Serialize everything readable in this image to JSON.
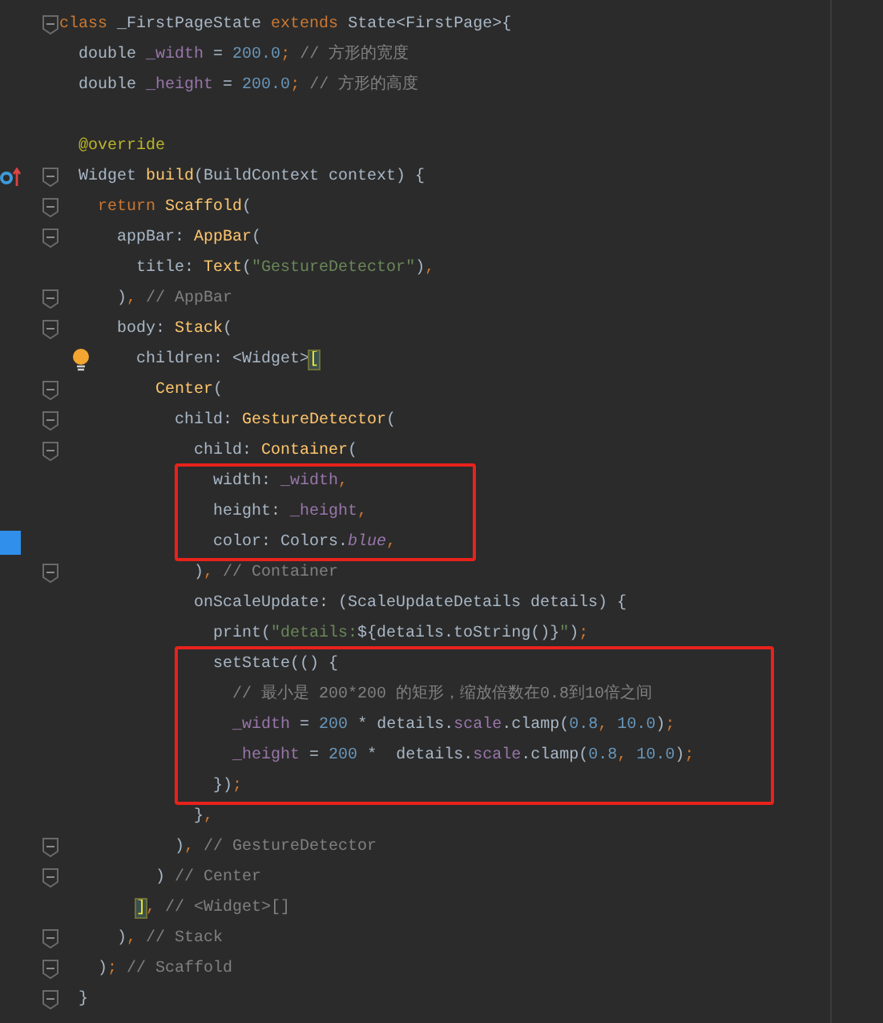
{
  "lines": [
    {
      "kind": "line",
      "fold": true,
      "tokens": [
        {
          "kind": "keyword",
          "text": "class"
        },
        {
          "kind": "plain",
          "text": " _FirstPageState "
        },
        {
          "kind": "keyword",
          "text": "extends"
        },
        {
          "kind": "plain",
          "text": " State<FirstPage>{"
        }
      ]
    },
    {
      "kind": "line",
      "fold": false,
      "tokens": [
        {
          "kind": "plain",
          "text": "  double "
        },
        {
          "kind": "field",
          "text": "_width"
        },
        {
          "kind": "plain",
          "text": " = "
        },
        {
          "kind": "number",
          "text": "200.0"
        },
        {
          "kind": "punct",
          "text": ";"
        },
        {
          "kind": "comment",
          "text": " // 方形的宽度"
        }
      ]
    },
    {
      "kind": "line",
      "fold": false,
      "tokens": [
        {
          "kind": "plain",
          "text": "  double "
        },
        {
          "kind": "field",
          "text": "_height"
        },
        {
          "kind": "plain",
          "text": " = "
        },
        {
          "kind": "number",
          "text": "200.0"
        },
        {
          "kind": "punct",
          "text": ";"
        },
        {
          "kind": "comment",
          "text": " // 方形的高度"
        }
      ]
    },
    {
      "kind": "blank",
      "fold": false
    },
    {
      "kind": "line",
      "fold": false,
      "tokens": [
        {
          "kind": "annotation",
          "text": "  @override"
        }
      ]
    },
    {
      "kind": "line",
      "fold": true,
      "gutter_icon": {
        "kind": "override"
      },
      "tokens": [
        {
          "kind": "plain",
          "text": "  Widget "
        },
        {
          "kind": "call",
          "text": "build"
        },
        {
          "kind": "plain",
          "text": "(BuildContext context) {"
        }
      ]
    },
    {
      "kind": "line",
      "fold": true,
      "tokens": [
        {
          "kind": "keyword",
          "text": "    return "
        },
        {
          "kind": "call",
          "text": "Scaffold"
        },
        {
          "kind": "plain",
          "text": "("
        }
      ]
    },
    {
      "kind": "line",
      "fold": true,
      "tokens": [
        {
          "kind": "plain",
          "text": "      appBar: "
        },
        {
          "kind": "call",
          "text": "AppBar"
        },
        {
          "kind": "plain",
          "text": "("
        }
      ]
    },
    {
      "kind": "line",
      "fold": false,
      "tokens": [
        {
          "kind": "plain",
          "text": "        title: "
        },
        {
          "kind": "call",
          "text": "Text"
        },
        {
          "kind": "plain",
          "text": "("
        },
        {
          "kind": "string",
          "text": "\"GestureDetector\""
        },
        {
          "kind": "plain",
          "text": ")"
        },
        {
          "kind": "punct",
          "text": ","
        }
      ]
    },
    {
      "kind": "line",
      "fold": true,
      "tokens": [
        {
          "kind": "plain",
          "text": "      )"
        },
        {
          "kind": "punct",
          "text": ","
        },
        {
          "kind": "comment",
          "text": " // AppBar"
        }
      ]
    },
    {
      "kind": "line",
      "fold": true,
      "tokens": [
        {
          "kind": "plain",
          "text": "      body: "
        },
        {
          "kind": "call",
          "text": "Stack"
        },
        {
          "kind": "plain",
          "text": "("
        }
      ]
    },
    {
      "kind": "line",
      "fold": false,
      "gutter_icon": {
        "kind": "bulb"
      },
      "tokens": [
        {
          "kind": "plain",
          "text": "        children: <Widget>"
        },
        {
          "kind": "brace",
          "text": "["
        }
      ]
    },
    {
      "kind": "line",
      "fold": true,
      "tokens": [
        {
          "kind": "call",
          "text": "          Center"
        },
        {
          "kind": "plain",
          "text": "("
        }
      ]
    },
    {
      "kind": "line",
      "fold": true,
      "tokens": [
        {
          "kind": "plain",
          "text": "            child: "
        },
        {
          "kind": "call",
          "text": "GestureDetector"
        },
        {
          "kind": "plain",
          "text": "("
        }
      ]
    },
    {
      "kind": "line",
      "fold": true,
      "tokens": [
        {
          "kind": "plain",
          "text": "              child: "
        },
        {
          "kind": "call",
          "text": "Container"
        },
        {
          "kind": "plain",
          "text": "("
        }
      ]
    },
    {
      "kind": "box",
      "lines": [
        {
          "kind": "line",
          "fold": false,
          "tokens": [
            {
              "kind": "plain",
              "text": "                width: "
            },
            {
              "kind": "field",
              "text": "_width"
            },
            {
              "kind": "punct",
              "text": ","
            }
          ]
        },
        {
          "kind": "line",
          "fold": false,
          "tokens": [
            {
              "kind": "plain",
              "text": "                height: "
            },
            {
              "kind": "field",
              "text": "_height"
            },
            {
              "kind": "punct",
              "text": ","
            }
          ]
        },
        {
          "kind": "line",
          "fold": false,
          "gutter_icon": {
            "kind": "square"
          },
          "tokens": [
            {
              "kind": "plain",
              "text": "                color: Colors."
            },
            {
              "kind": "italic",
              "text": "blue"
            },
            {
              "kind": "punct",
              "text": ","
            }
          ]
        }
      ]
    },
    {
      "kind": "line",
      "fold": true,
      "tokens": [
        {
          "kind": "plain",
          "text": "              )"
        },
        {
          "kind": "punct",
          "text": ","
        },
        {
          "kind": "comment",
          "text": " // Container"
        }
      ]
    },
    {
      "kind": "line",
      "fold": false,
      "tokens": [
        {
          "kind": "plain",
          "text": "              onScaleUpdate: (ScaleUpdateDetails details) {"
        }
      ]
    },
    {
      "kind": "line",
      "fold": false,
      "tokens": [
        {
          "kind": "plain",
          "text": "                print("
        },
        {
          "kind": "string",
          "text": "\"details:"
        },
        {
          "kind": "plain",
          "text": "${details.toString()}"
        },
        {
          "kind": "string",
          "text": "\""
        },
        {
          "kind": "plain",
          "text": ")"
        },
        {
          "kind": "punct",
          "text": ";"
        }
      ]
    },
    {
      "kind": "box",
      "lines": [
        {
          "kind": "line",
          "fold": false,
          "tokens": [
            {
              "kind": "plain",
              "text": "                setState(() {"
            }
          ]
        },
        {
          "kind": "line",
          "fold": false,
          "tokens": [
            {
              "kind": "comment",
              "text": "                  // 最小是 200*200 的矩形，缩放倍数在0.8到10倍之间"
            }
          ]
        },
        {
          "kind": "line",
          "fold": false,
          "tokens": [
            {
              "kind": "field",
              "text": "                  _width"
            },
            {
              "kind": "plain",
              "text": " = "
            },
            {
              "kind": "number",
              "text": "200"
            },
            {
              "kind": "plain",
              "text": " * details."
            },
            {
              "kind": "field",
              "text": "scale"
            },
            {
              "kind": "plain",
              "text": ".clamp("
            },
            {
              "kind": "number",
              "text": "0.8"
            },
            {
              "kind": "punct",
              "text": ","
            },
            {
              "kind": "number",
              "text": " 10.0"
            },
            {
              "kind": "plain",
              "text": ")"
            },
            {
              "kind": "punct",
              "text": ";"
            }
          ]
        },
        {
          "kind": "line",
          "fold": false,
          "tokens": [
            {
              "kind": "field",
              "text": "                  _height"
            },
            {
              "kind": "plain",
              "text": " = "
            },
            {
              "kind": "number",
              "text": "200"
            },
            {
              "kind": "plain",
              "text": " *  details."
            },
            {
              "kind": "field",
              "text": "scale"
            },
            {
              "kind": "plain",
              "text": ".clamp("
            },
            {
              "kind": "number",
              "text": "0.8"
            },
            {
              "kind": "punct",
              "text": ","
            },
            {
              "kind": "number",
              "text": " 10.0"
            },
            {
              "kind": "plain",
              "text": ")"
            },
            {
              "kind": "punct",
              "text": ";"
            }
          ]
        },
        {
          "kind": "line",
          "fold": false,
          "tokens": [
            {
              "kind": "plain",
              "text": "                })"
            },
            {
              "kind": "punct",
              "text": ";"
            }
          ]
        }
      ]
    },
    {
      "kind": "line",
      "fold": false,
      "tokens": [
        {
          "kind": "plain",
          "text": "              }"
        },
        {
          "kind": "punct",
          "text": ","
        }
      ]
    },
    {
      "kind": "line",
      "fold": true,
      "tokens": [
        {
          "kind": "plain",
          "text": "            )"
        },
        {
          "kind": "punct",
          "text": ","
        },
        {
          "kind": "comment",
          "text": " // GestureDetector"
        }
      ]
    },
    {
      "kind": "line",
      "fold": true,
      "tokens": [
        {
          "kind": "plain",
          "text": "          ) "
        },
        {
          "kind": "comment",
          "text": "// Center"
        }
      ]
    },
    {
      "kind": "line",
      "fold": false,
      "tokens": [
        {
          "kind": "brace",
          "text": "        ]"
        },
        {
          "kind": "punct",
          "text": ","
        },
        {
          "kind": "comment",
          "text": " // <Widget>[]"
        }
      ]
    },
    {
      "kind": "line",
      "fold": true,
      "tokens": [
        {
          "kind": "plain",
          "text": "      )"
        },
        {
          "kind": "punct",
          "text": ","
        },
        {
          "kind": "comment",
          "text": " // Stack"
        }
      ]
    },
    {
      "kind": "line",
      "fold": true,
      "tokens": [
        {
          "kind": "plain",
          "text": "    )"
        },
        {
          "kind": "punct",
          "text": ";"
        },
        {
          "kind": "comment",
          "text": " // Scaffold"
        }
      ]
    },
    {
      "kind": "line",
      "fold": true,
      "tokens": [
        {
          "kind": "plain",
          "text": "  }"
        }
      ]
    }
  ]
}
